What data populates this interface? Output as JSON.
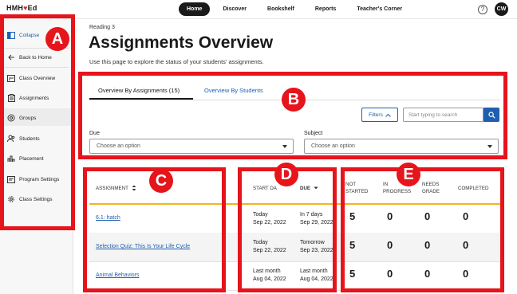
{
  "brand": {
    "name": "HMH",
    "heart": "♥",
    "suffix": "Ed"
  },
  "nav": {
    "items": [
      "Home",
      "Discover",
      "Bookshelf",
      "Reports",
      "Teacher's Corner"
    ],
    "active": "Home"
  },
  "help_glyph": "?",
  "avatar_initials": "CW",
  "sidebar": {
    "collapse_label": "Collapse",
    "items": [
      "Back to Home",
      "Class Overview",
      "Assignments",
      "Groups",
      "Students",
      "Placement",
      "Program Settings",
      "Class Settings"
    ],
    "active": "Assignments"
  },
  "header": {
    "crumb": "Reading 3",
    "title": "Assignments Overview",
    "description": "Use this page to explore the status of your students' assignments."
  },
  "tabs": {
    "by_assignments": "Overview By Assignments (15)",
    "by_students": "Overview By Students"
  },
  "filters": {
    "button_label": "Filters",
    "search_placeholder": "Start typing to search",
    "due_label": "Due",
    "due_placeholder": "Choose an option",
    "subject_label": "Subject",
    "subject_placeholder": "Choose an option"
  },
  "table": {
    "headers": {
      "assignment": "ASSIGNMENT",
      "start_date": "START DA",
      "due": "DUE",
      "not_started_1": "NOT",
      "not_started_2": "STARTED",
      "in_progress_1": "IN",
      "in_progress_2": "PROGRESS",
      "needs_grade_1": "NEEDS",
      "needs_grade_2": "GRADE",
      "completed": "COMPLETED"
    },
    "rows": [
      {
        "name": "6.1: hatch",
        "start_rel": "Today",
        "start_date": "Sep 22, 2022",
        "due_rel": "In 7 days",
        "due_date": "Sep 29, 2022",
        "not_started": "5",
        "in_progress": "0",
        "needs_grade": "0",
        "completed": "0"
      },
      {
        "name": "Selection Quiz: This Is Your Life Cycle",
        "start_rel": "Today",
        "start_date": "Sep 22, 2022",
        "due_rel": "Tomorrow",
        "due_date": "Sep 23, 2022",
        "not_started": "5",
        "in_progress": "0",
        "needs_grade": "0",
        "completed": "0"
      },
      {
        "name": "Animal Behaviors",
        "start_rel": "Last month",
        "start_date": "Aug 04, 2022",
        "due_rel": "Last month",
        "due_date": "Aug 04, 2022",
        "not_started": "5",
        "in_progress": "0",
        "needs_grade": "0",
        "completed": "0"
      }
    ]
  },
  "annotations": {
    "a": "A",
    "b": "B",
    "c": "C",
    "d": "D",
    "e": "E"
  },
  "colors": {
    "annotation_red": "#e6141b",
    "link_blue": "#1f5fb0",
    "header_accent": "#f5b31b"
  }
}
